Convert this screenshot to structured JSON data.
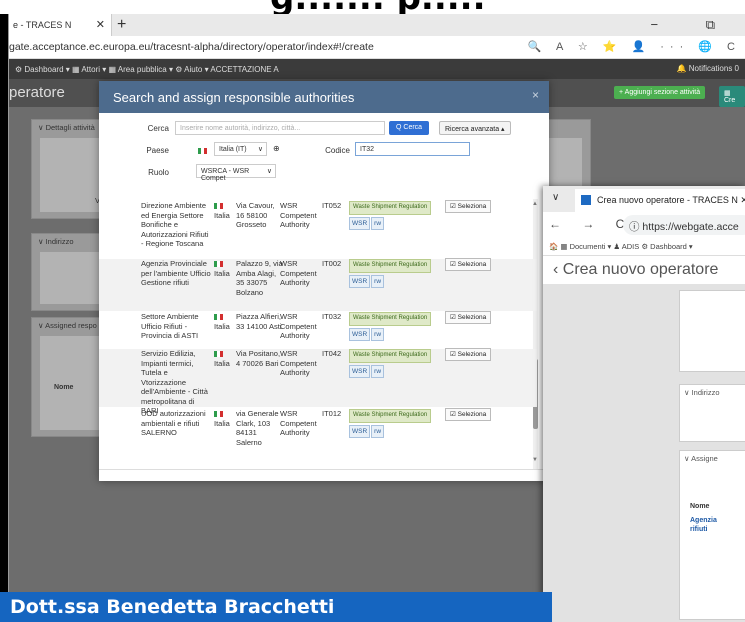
{
  "slide": {
    "caption": "Dott.ssa Benedetta Bracchetti"
  },
  "browser1": {
    "tab_title": "e - TRACES N",
    "tab_close": "✕",
    "new_tab": "+",
    "window_controls": "−  ⧉",
    "url": "gate.acceptance.ec.europa.eu/tracesnt-alpha/directory/operator/index#!/create",
    "url_icons": "🔍 A ☆ ⭐ 👤 ··· 🌐 C"
  },
  "appnav": {
    "items": "⚙ Dashboard ▾    ▦ Attori ▾    ▦ Area pubblica ▾    ⚙ Aiuto ▾    ACCETTAZIONE A",
    "notifications": "🔔 Notifications 0"
  },
  "page": {
    "title": "peratore",
    "add_activity": "+ Aggiungi sezione attività",
    "create": "▦ Cre"
  },
  "cards": {
    "details": "∨ Dettagli attività",
    "va": "Va",
    "address": "∨ Indirizzo",
    "assigned": "∨ Assigned respo",
    "nome": "Nome"
  },
  "modal": {
    "title": "Search and assign responsible authorities",
    "close": "×",
    "search_label": "Cerca",
    "search_placeholder": "Inserire nome autorità, indirizzo, città...",
    "search_button": "Q Cerca",
    "advanced_button": "Ricerca avanzata ▴",
    "country_label": "Paese",
    "country_value": "Italia (IT)",
    "code_label": "Codice",
    "code_value": "IT32",
    "role_label": "Ruolo",
    "role_value": "WSRCA - WSR Compet",
    "rows": [
      {
        "name": "Direzione Ambiente ed Energia Settore Bonifiche e Autorizzazioni Rifiuti - Regione Toscana",
        "country": "Italia",
        "address": "Via Cavour, 16 58100 Grosseto",
        "role": "WSR Competent Authority",
        "code": "IT052",
        "tag": "Waste Shipment Regulation",
        "tag_a": "WSR",
        "tag_b": "rw",
        "select": "☑ Seleziona"
      },
      {
        "name": "Agenzia Provinciale per l'ambiente Ufficio Gestione rifiuti",
        "country": "Italia",
        "address": "Palazzo 9, via Amba Alagi, 35 33075 Bolzano",
        "role": "WSR Competent Authority",
        "code": "IT002",
        "tag": "Waste Shipment Regulation",
        "tag_a": "WSR",
        "tag_b": "rw",
        "select": "☑ Seleziona"
      },
      {
        "name": "Settore Ambiente Ufficio Rifiuti - Provincia di ASTI",
        "country": "Italia",
        "address": "Piazza Alfieri, 33 14100 Asti",
        "role": "WSR Competent Authority",
        "code": "IT032",
        "tag": "Waste Shipment Regulation",
        "tag_a": "WSR",
        "tag_b": "rw",
        "select": "☑ Seleziona"
      },
      {
        "name": "Servizio Edilizia, Impianti termici, Tutela e Vtorizzazione dell'Ambiente - Città metropolitana di BARI",
        "country": "Italia",
        "address": "Via Positano, 4 70026 Bari",
        "role": "WSR Competent Authority",
        "code": "IT042",
        "tag": "Waste Shipment Regulation",
        "tag_a": "WSR",
        "tag_b": "rw",
        "select": "☑ Seleziona"
      },
      {
        "name": "UOD autorizzazioni ambientali e rifiuti SALERNO",
        "country": "Italia",
        "address": "via Generale Clark, 103 84131 Salerno",
        "role": "WSR Competent Authority",
        "code": "IT012",
        "tag": "Waste Shipment Regulation",
        "tag_a": "WSR",
        "tag_b": "rw",
        "select": "☑ Seleziona"
      }
    ],
    "scroll_position": 0.62
  },
  "browser2": {
    "tab_dropdown": "∨",
    "tab_title": "Crea nuovo operatore - TRACES N ✕",
    "nav": "← → C",
    "url": "ⓘ https://webgate.acce",
    "bookmarks": "🏠  ▦ Documenti ▾   ♟ ADIS   ⚙ Dashboard ▾",
    "page_title": "‹ Crea nuovo operatore",
    "address_label": "∨ Indirizzo",
    "assigned_label": "∨ Assigne",
    "table_header": "Nome",
    "table_link": "Agenzia rifiuti"
  }
}
